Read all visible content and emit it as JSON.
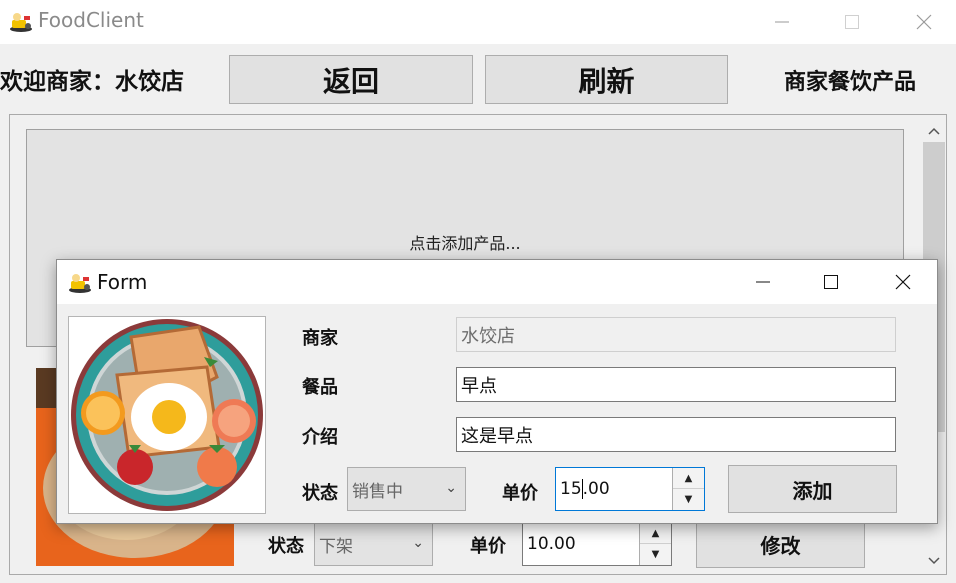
{
  "app": {
    "title": "FoodClient",
    "icon": "food-app-icon"
  },
  "header": {
    "welcome": "欢迎商家：水饺店",
    "back_label": "返回",
    "refresh_label": "刷新",
    "section_title": "商家餐饮产品"
  },
  "panel": {
    "add_prompt": "点击添加产品..."
  },
  "product_row": {
    "status_label": "状态",
    "status_value": "下架",
    "price_label": "单价",
    "price_value": "10.00",
    "modify_label": "修改"
  },
  "dialog": {
    "title": "Form",
    "merchant_label": "商家",
    "merchant_value": "水饺店",
    "food_label": "餐品",
    "food_value": "早点",
    "intro_label": "介绍",
    "intro_value": "这是早点",
    "status_label": "状态",
    "status_value": "销售中",
    "price_label": "单价",
    "price_before_caret": "15",
    "price_after_caret": ".00",
    "submit_label": "添加"
  },
  "colors": {
    "focus_border": "#0078d7",
    "window_bg": "#f0f0f0",
    "button_bg": "#e1e1e1"
  }
}
